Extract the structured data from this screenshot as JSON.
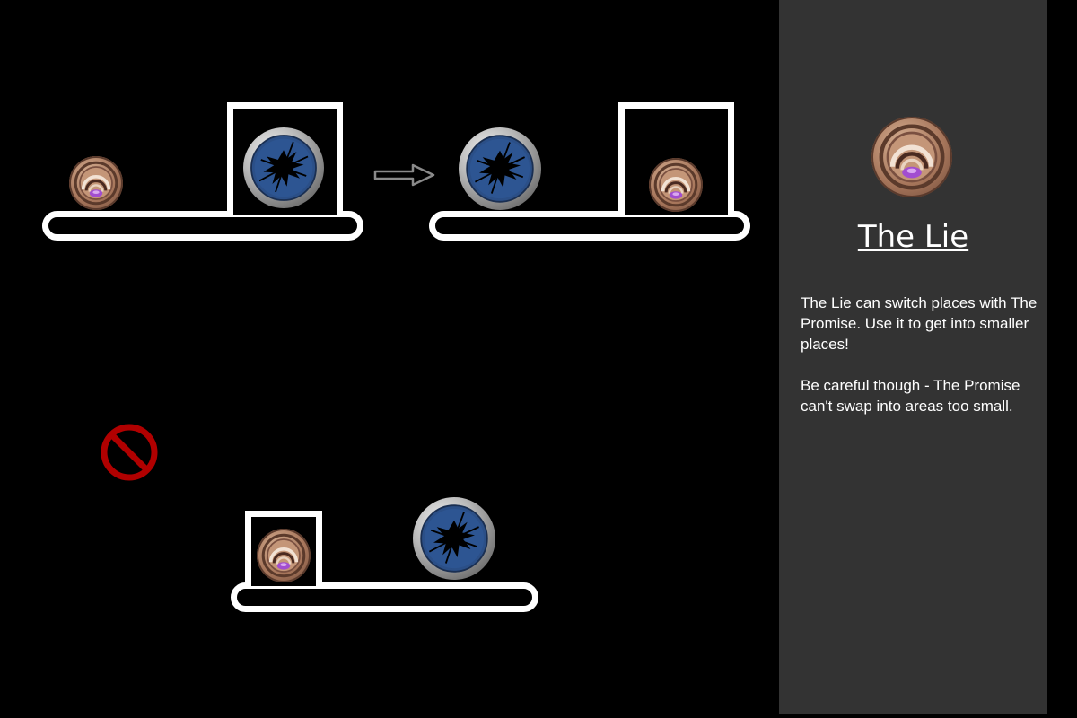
{
  "panel": {
    "title": "The Lie",
    "description": "The Lie can switch places with The Promise. Use it to get into smaller places!",
    "warning": "Be careful though - The Promise can't swap into areas too small."
  },
  "icons": {
    "lie": "lie-orb-icon",
    "promise": "promise-orb-icon",
    "arrow": "arrow-right-icon",
    "prohibited": "no-entry-icon"
  },
  "colors": {
    "background": "#000000",
    "panel": "#333333",
    "text": "#ffffff",
    "prohibited": "#b00000",
    "promise_blue": "#2a4f86",
    "lie_bronze": "#a7765b"
  }
}
